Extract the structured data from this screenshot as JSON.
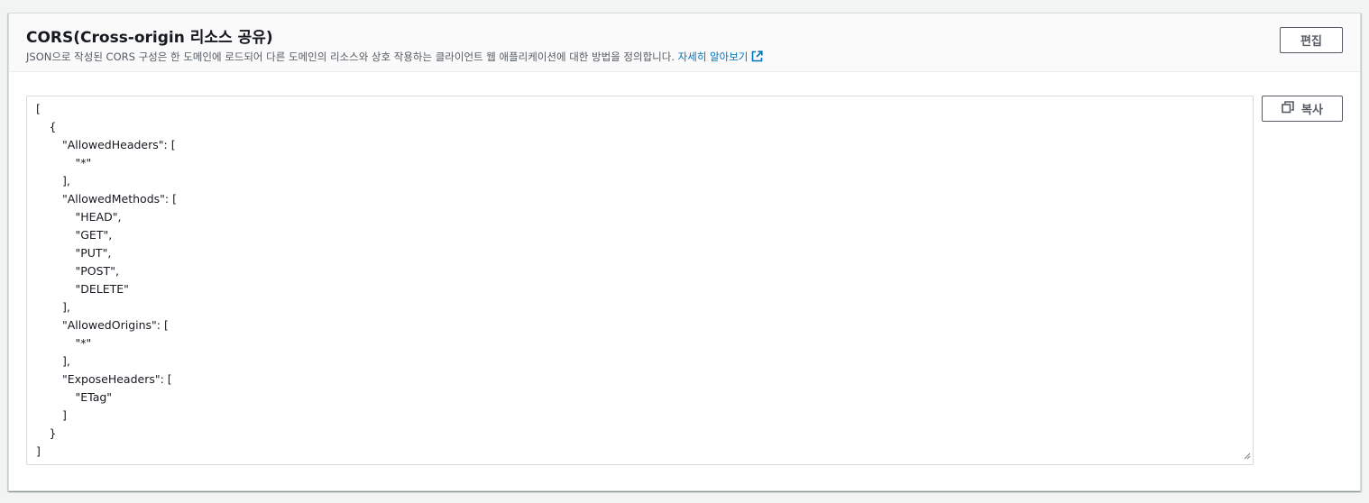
{
  "header": {
    "title": "CORS(Cross-origin 리소스 공유)",
    "description": "JSON으로 작성된 CORS 구성은 한 도메인에 로드되어 다른 도메인의 리소스와 상호 작용하는 클라이언트 웹 애플리케이션에 대한 방법을 정의합니다.",
    "learn_more": "자세히 알아보기",
    "edit_label": "편집"
  },
  "editor": {
    "copy_label": "복사",
    "lines": [
      {
        "indent": 0,
        "text": "["
      },
      {
        "indent": 1,
        "text": "{"
      },
      {
        "indent": 2,
        "text": "\"AllowedHeaders\": ["
      },
      {
        "indent": 3,
        "text": "\"*\""
      },
      {
        "indent": 2,
        "text": "],"
      },
      {
        "indent": 2,
        "text": "\"AllowedMethods\": ["
      },
      {
        "indent": 3,
        "text": "\"HEAD\","
      },
      {
        "indent": 3,
        "text": "\"GET\","
      },
      {
        "indent": 3,
        "text": "\"PUT\","
      },
      {
        "indent": 3,
        "text": "\"POST\","
      },
      {
        "indent": 3,
        "text": "\"DELETE\""
      },
      {
        "indent": 2,
        "text": "],"
      },
      {
        "indent": 2,
        "text": "\"AllowedOrigins\": ["
      },
      {
        "indent": 3,
        "text": "\"*\""
      },
      {
        "indent": 2,
        "text": "],"
      },
      {
        "indent": 2,
        "text": "\"ExposeHeaders\": ["
      },
      {
        "indent": 3,
        "text": "\"ETag\""
      },
      {
        "indent": 2,
        "text": "]"
      },
      {
        "indent": 1,
        "text": "}"
      },
      {
        "indent": 0,
        "text": "]"
      }
    ]
  },
  "colors": {
    "link": "#0073bb",
    "text": "#16191f",
    "muted": "#545b64"
  }
}
